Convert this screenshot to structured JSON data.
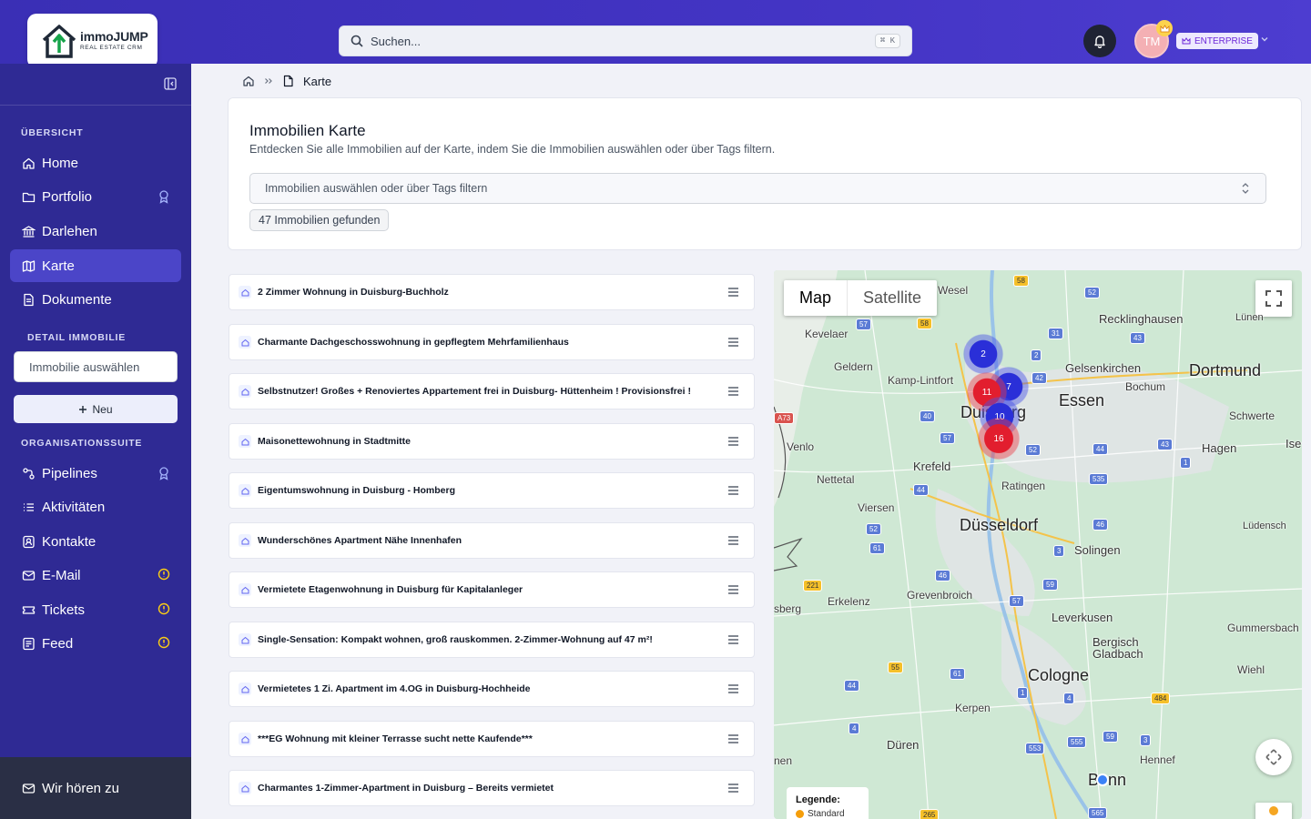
{
  "brand": {
    "name": "immoJUMP",
    "tagline": "REAL ESTATE CRM"
  },
  "search": {
    "placeholder": "Suchen...",
    "shortcut": "⌘ K"
  },
  "user": {
    "initials": "TM",
    "plan": "ENTERPRISE"
  },
  "sidebar": {
    "section_overview": "ÜBERSICHT",
    "overview_items": [
      {
        "label": "Home",
        "icon": "home-icon"
      },
      {
        "label": "Portfolio",
        "icon": "folder-icon",
        "badge": "premium-icon"
      },
      {
        "label": "Darlehen",
        "icon": "bank-icon"
      },
      {
        "label": "Karte",
        "icon": "map-icon",
        "active": true
      },
      {
        "label": "Dokumente",
        "icon": "document-icon"
      }
    ],
    "section_detail": "DETAIL IMMOBILIE",
    "property_select_placeholder": "Immobilie auswählen",
    "new_button": "Neu",
    "section_org": "ORGANISATIONSSUITE",
    "org_items": [
      {
        "label": "Pipelines",
        "icon": "pipeline-icon",
        "badge": "premium-icon"
      },
      {
        "label": "Aktivitäten",
        "icon": "list-icon"
      },
      {
        "label": "Kontakte",
        "icon": "contact-icon"
      },
      {
        "label": "E-Mail",
        "icon": "mail-icon",
        "badge": "warning-icon"
      },
      {
        "label": "Tickets",
        "icon": "ticket-icon",
        "badge": "warning-icon"
      },
      {
        "label": "Feed",
        "icon": "feed-icon",
        "badge": "warning-icon"
      }
    ],
    "feedback": "Wir hören zu"
  },
  "breadcrumb": {
    "current": "Karte"
  },
  "page": {
    "title": "Immobilien Karte",
    "subtitle": "Entdecken Sie alle Immobilien auf der Karte, indem Sie die Immobilien auswählen oder über Tags filtern.",
    "filter_placeholder": "Immobilien auswählen oder über Tags filtern",
    "found_count": "47 Immobilien gefunden"
  },
  "properties": [
    "2 Zimmer Wohnung in Duisburg-Buchholz",
    "Charmante Dachgeschosswohnung in gepflegtem Mehrfamilienhaus",
    "Selbstnutzer! Großes + Renoviertes Appartement frei in Duisburg- Hüttenheim ! Provisionsfrei !",
    "Maisonettewohnung in Stadtmitte",
    "Eigentumswohnung in Duisburg - Homberg",
    "Wunderschönes Apartment Nähe Innenhafen",
    "Vermietete Etagenwohnung in Duisburg für Kapitalanleger",
    "Single-Sensation: Kompakt wohnen, groß rauskommen. 2-Zimmer-Wohnung auf 47 m²!",
    "Vermietetes 1 Zi. Apartment im 4.OG in Duisburg-Hochheide",
    "***EG Wohnung mit kleiner Terrasse sucht nette Kaufende***",
    "Charmantes 1-Zimmer-Apartment in Duisburg – Bereits vermietet"
  ],
  "map": {
    "tabs": [
      "Map",
      "Satellite"
    ],
    "active_tab": "Map",
    "legend_title": "Legende:",
    "legend_items": [
      "Standard"
    ],
    "clusters": [
      {
        "count": "2",
        "color": "blue"
      },
      {
        "count": "7",
        "color": "blue"
      },
      {
        "count": "11",
        "color": "red"
      },
      {
        "count": "10",
        "color": "blue"
      },
      {
        "count": "16",
        "color": "red"
      }
    ],
    "places": {
      "wesel": "Wesel",
      "recklinghausen": "Recklinghausen",
      "luenen": "Lünen",
      "kevelaer": "Kevelaer",
      "geldern": "Geldern",
      "kamp_lintfort": "Kamp-Lintfort",
      "gelsenkirchen": "Gelsenkirchen",
      "dortmund": "Dortmund",
      "bochum": "Bochum",
      "essen": "Essen",
      "duisburg": "Duisburg",
      "schwerte": "Schwerte",
      "venlo": "Venlo",
      "hagen": "Hagen",
      "ise": "Ise",
      "krefeld": "Krefeld",
      "nettetal": "Nettetal",
      "ratingen": "Ratingen",
      "viersen": "Viersen",
      "duesseldorf": "Düsseldorf",
      "luedensch": "Lüdensch",
      "solingen": "Solingen",
      "grevenbroich": "Grevenbroich",
      "sberg": "sberg",
      "erkelenz": "Erkelenz",
      "leverkusen": "Leverkusen",
      "gummersbach": "Gummersbach",
      "bergisch": "Bergisch",
      "gladbach": "Gladbach",
      "cologne": "Cologne",
      "wiehl": "Wiehl",
      "kerpen": "Kerpen",
      "dueren": "Düren",
      "nen": "nen",
      "hennef": "Hennef",
      "bonn": "Bonn"
    },
    "roads": [
      "58",
      "52",
      "57",
      "58",
      "31",
      "43",
      "2",
      "42",
      "A73",
      "40",
      "57",
      "52",
      "44",
      "43",
      "1",
      "44",
      "535",
      "52",
      "61",
      "46",
      "3",
      "46",
      "221",
      "59",
      "57",
      "55",
      "44",
      "61",
      "1",
      "4",
      "484",
      "4",
      "59",
      "555",
      "553",
      "3",
      "265",
      "565"
    ]
  },
  "colors": {
    "primary": "#3a2fb5",
    "sidebar": "#2f2a94",
    "active": "#4b45c8",
    "warning": "#facc15"
  }
}
